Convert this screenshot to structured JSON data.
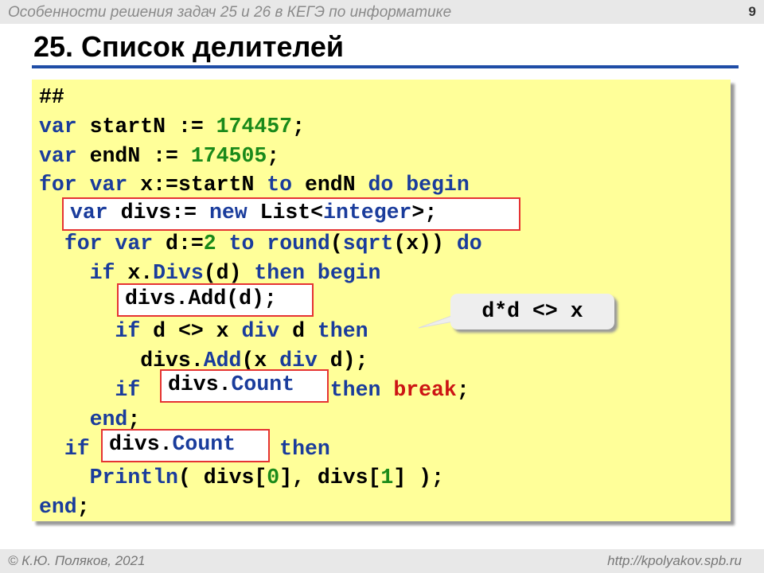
{
  "header": {
    "subtitle": "Особенности решения задач 25 и 26 в КЕГЭ по информатике",
    "page_number": "9"
  },
  "slide": {
    "title": "25. Список делителей"
  },
  "code": {
    "lines": [
      [
        {
          "t": "##",
          "c": "plain"
        }
      ],
      [
        {
          "t": "var",
          "c": "kw"
        },
        {
          "t": " startN := ",
          "c": "plain"
        },
        {
          "t": "174457",
          "c": "num"
        },
        {
          "t": ";",
          "c": "plain"
        }
      ],
      [
        {
          "t": "var",
          "c": "kw"
        },
        {
          "t": " endN := ",
          "c": "plain"
        },
        {
          "t": "174505",
          "c": "num"
        },
        {
          "t": ";",
          "c": "plain"
        }
      ],
      [
        {
          "t": "for var",
          "c": "kw"
        },
        {
          "t": " x:=startN ",
          "c": "plain"
        },
        {
          "t": "to",
          "c": "kw"
        },
        {
          "t": " endN ",
          "c": "plain"
        },
        {
          "t": "do begin",
          "c": "kw"
        }
      ],
      [
        {
          "t": "  ",
          "c": "plain"
        }
      ],
      [
        {
          "t": "  ",
          "c": "plain"
        },
        {
          "t": "for var",
          "c": "kw"
        },
        {
          "t": " d:=",
          "c": "plain"
        },
        {
          "t": "2",
          "c": "num"
        },
        {
          "t": " ",
          "c": "plain"
        },
        {
          "t": "to",
          "c": "kw"
        },
        {
          "t": " ",
          "c": "plain"
        },
        {
          "t": "round",
          "c": "kw"
        },
        {
          "t": "(",
          "c": "plain"
        },
        {
          "t": "sqrt",
          "c": "kw"
        },
        {
          "t": "(x)) ",
          "c": "plain"
        },
        {
          "t": "do",
          "c": "kw"
        }
      ],
      [
        {
          "t": "    ",
          "c": "plain"
        },
        {
          "t": "if",
          "c": "kw"
        },
        {
          "t": " x.",
          "c": "plain"
        },
        {
          "t": "Divs",
          "c": "kw"
        },
        {
          "t": "(d) ",
          "c": "plain"
        },
        {
          "t": "then begin",
          "c": "kw"
        }
      ],
      [
        {
          "t": "      ",
          "c": "plain"
        }
      ],
      [
        {
          "t": "      ",
          "c": "plain"
        },
        {
          "t": "if",
          "c": "kw"
        },
        {
          "t": " d <> x ",
          "c": "plain"
        },
        {
          "t": "div",
          "c": "kw"
        },
        {
          "t": " d ",
          "c": "plain"
        },
        {
          "t": "then",
          "c": "kw"
        }
      ],
      [
        {
          "t": "        divs.",
          "c": "plain"
        },
        {
          "t": "Add",
          "c": "kw"
        },
        {
          "t": "(x ",
          "c": "plain"
        },
        {
          "t": "div",
          "c": "kw"
        },
        {
          "t": " d);",
          "c": "plain"
        }
      ],
      [
        {
          "t": "      ",
          "c": "plain"
        },
        {
          "t": "if",
          "c": "kw"
        },
        {
          "t": "           > ",
          "c": "plain"
        },
        {
          "t": "2",
          "c": "num"
        },
        {
          "t": " ",
          "c": "plain"
        },
        {
          "t": "then",
          "c": "kw"
        },
        {
          "t": " ",
          "c": "plain"
        },
        {
          "t": "break",
          "c": "red"
        },
        {
          "t": ";",
          "c": "plain"
        }
      ],
      [
        {
          "t": "    ",
          "c": "plain"
        },
        {
          "t": "end",
          "c": "kw"
        },
        {
          "t": ";",
          "c": "plain"
        }
      ],
      [
        {
          "t": "  ",
          "c": "plain"
        },
        {
          "t": "if",
          "c": "kw"
        },
        {
          "t": "           = ",
          "c": "plain"
        },
        {
          "t": "2",
          "c": "num"
        },
        {
          "t": " ",
          "c": "plain"
        },
        {
          "t": "then",
          "c": "kw"
        }
      ],
      [
        {
          "t": "    ",
          "c": "plain"
        },
        {
          "t": "Println",
          "c": "kw"
        },
        {
          "t": "( divs[",
          "c": "plain"
        },
        {
          "t": "0",
          "c": "num"
        },
        {
          "t": "], divs[",
          "c": "plain"
        },
        {
          "t": "1",
          "c": "num"
        },
        {
          "t": "] );",
          "c": "plain"
        }
      ],
      [
        {
          "t": "end",
          "c": "kw"
        },
        {
          "t": ";",
          "c": "plain"
        }
      ]
    ],
    "box_list": [
      {
        "t": "var",
        "c": "kw"
      },
      {
        "t": " divs:= ",
        "c": "plain"
      },
      {
        "t": "new",
        "c": "kw"
      },
      {
        "t": " List<",
        "c": "plain"
      },
      {
        "t": "integer",
        "c": "kw"
      },
      {
        "t": ">;",
        "c": "plain"
      }
    ],
    "box_add": [
      {
        "t": "divs.Add(d);",
        "c": "plain"
      }
    ],
    "box_count1": [
      {
        "t": "divs.",
        "c": "plain"
      },
      {
        "t": "Count",
        "c": "kw"
      }
    ],
    "box_count2": [
      {
        "t": "divs.",
        "c": "plain"
      },
      {
        "t": "Count",
        "c": "kw"
      }
    ]
  },
  "callout": {
    "text": "d*d <> x"
  },
  "footer": {
    "author": "© К.Ю. Поляков, 2021",
    "url": "http://kpolyakov.spb.ru"
  }
}
